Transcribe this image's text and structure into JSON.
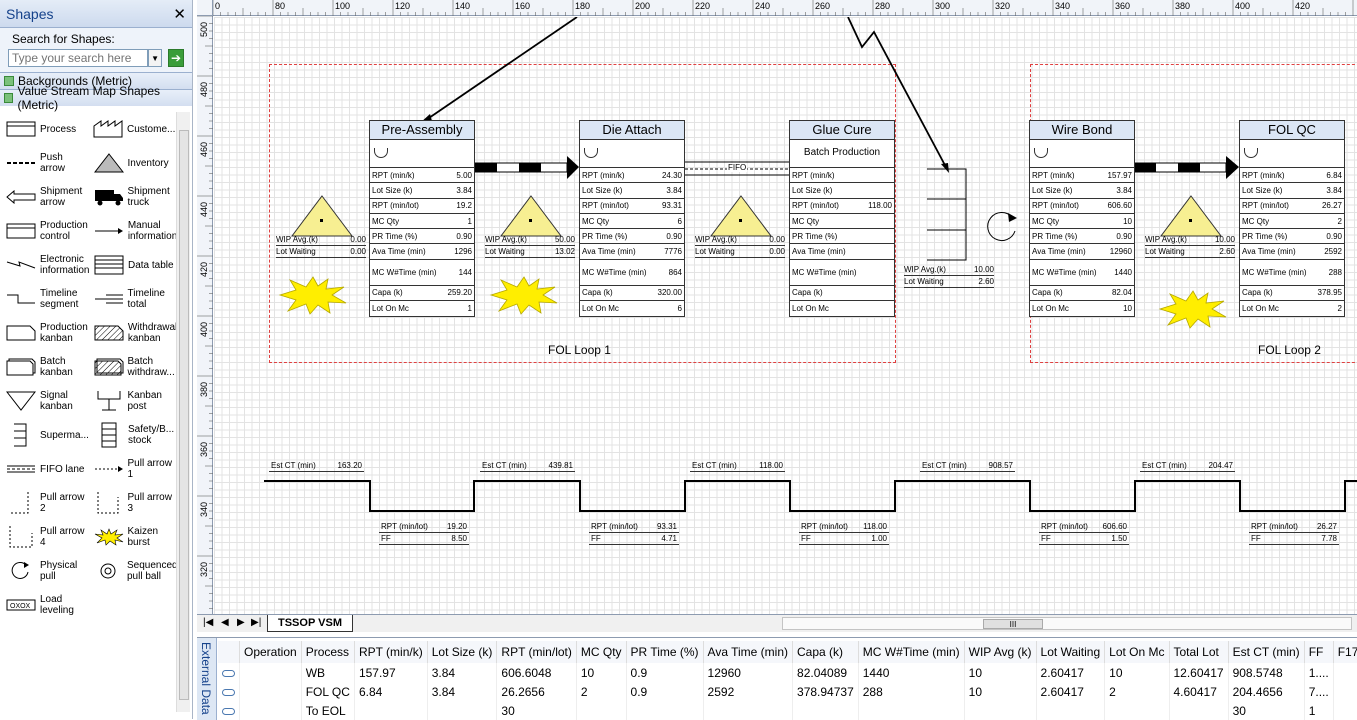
{
  "shapes_panel": {
    "title": "Shapes",
    "close_glyph": "✕",
    "search_label": "Search for Shapes:",
    "search_placeholder": "Type your search here",
    "stencils": [
      "Backgrounds (Metric)",
      "Value Stream Map Shapes (Metric)"
    ],
    "shapes": [
      [
        "Process",
        "Custome..."
      ],
      [
        "Push arrow",
        "Inventory"
      ],
      [
        "Shipment arrow",
        "Shipment truck"
      ],
      [
        "Production control",
        "Manual information"
      ],
      [
        "Electronic information",
        "Data table"
      ],
      [
        "Timeline segment",
        "Timeline total"
      ],
      [
        "Production kanban",
        "Withdrawal kanban"
      ],
      [
        "Batch kanban",
        "Batch withdraw..."
      ],
      [
        "Signal kanban",
        "Kanban post"
      ],
      [
        "",
        "Safety/B... stock"
      ],
      [
        "FIFO lane",
        "Pull arrow 1"
      ],
      [
        "Pull arrow 2",
        "Pull arrow 3"
      ],
      [
        "Pull arrow 4",
        "Kaizen burst"
      ],
      [
        "Physical pull",
        "Sequenced pull ball"
      ],
      [
        "Load leveling",
        ""
      ]
    ],
    "supermarket_label": "Superma..."
  },
  "ruler": {
    "top_ticks": [
      "0",
      "80",
      "100",
      "120",
      "140",
      "160",
      "180",
      "200",
      "220",
      "240",
      "260",
      "280",
      "300",
      "320",
      "340",
      "360",
      "380",
      "400",
      "420"
    ],
    "left_ticks": [
      "500",
      "480",
      "460",
      "440",
      "420",
      "400",
      "380",
      "360",
      "340",
      "320"
    ]
  },
  "diagram": {
    "loops": [
      "FOL Loop 1",
      "FOL Loop 2"
    ],
    "fifo_label": "FIFO",
    "row_labels": [
      "RPT (min/k)",
      "Lot Size (k)",
      "RPT (min/lot)",
      "MC Qty",
      "PR Time (%)",
      "Ava Time (min)",
      "MC W#Time (min)",
      "Capa (k)",
      "Lot On Mc"
    ],
    "processes": [
      {
        "title": "Pre-Assembly",
        "batch": "",
        "values": [
          "5.00",
          "3.84",
          "19.2",
          "1",
          "0.90",
          "1296",
          "144",
          "259.20",
          "1"
        ]
      },
      {
        "title": "Die Attach",
        "batch": "",
        "values": [
          "24.30",
          "3.84",
          "93.31",
          "6",
          "0.90",
          "7776",
          "864",
          "320.00",
          "6"
        ]
      },
      {
        "title": "Glue Cure",
        "batch": "Batch Production",
        "values": [
          "",
          "",
          "118.00",
          "",
          "",
          "",
          "",
          "",
          ""
        ]
      },
      {
        "title": "Wire Bond",
        "batch": "",
        "values": [
          "157.97",
          "3.84",
          "606.60",
          "10",
          "0.90",
          "12960",
          "1440",
          "82.04",
          "10"
        ]
      },
      {
        "title": "FOL QC",
        "batch": "",
        "values": [
          "6.84",
          "3.84",
          "26.27",
          "2",
          "0.90",
          "2592",
          "288",
          "378.95",
          "2"
        ]
      }
    ],
    "wip_label": "WIP Avg.(k)",
    "lot_waiting_label": "Lot Waiting",
    "inventories": [
      {
        "wip": "0.00",
        "lot": "0.00"
      },
      {
        "wip": "50.00",
        "lot": "13.02"
      },
      {
        "wip": "0.00",
        "lot": "0.00"
      },
      {
        "wip": "10.00",
        "lot": "2.60"
      },
      {
        "wip": "10.00",
        "lot": "2.60"
      }
    ],
    "timeline": {
      "est_ct_label": "Est CT (min)",
      "rpt_label": "RPT (min/lot)",
      "ff_label": "FF",
      "est_ct": [
        "163.20",
        "439.81",
        "118.00",
        "908.57",
        "204.47"
      ],
      "rpt": [
        "19.20",
        "93.31",
        "118.00",
        "606.60",
        "26.27"
      ],
      "ff": [
        "8.50",
        "4.71",
        "1.00",
        "1.50",
        "7.78"
      ]
    }
  },
  "tabs": {
    "nav": [
      "|◀",
      "◀",
      "▶",
      "▶|"
    ],
    "active_tab": "TSSOP VSM",
    "scroll_glyph": "III"
  },
  "external_data": {
    "side_label": "External Data",
    "columns": [
      "",
      "Operation",
      "Process",
      "RPT (min/k)",
      "Lot Size (k)",
      "RPT (min/lot)",
      "MC Qty",
      "PR Time (%)",
      "Ava Time (min)",
      "Capa (k)",
      "MC W#Time (min)",
      "WIP Avg (k)",
      "Lot Waiting",
      "Lot On Mc",
      "Total Lot",
      "Est CT (min)",
      "FF",
      "F17"
    ],
    "rows": [
      [
        "",
        "",
        "WB",
        "157.97",
        "3.84",
        "606.6048",
        "10",
        "0.9",
        "12960",
        "82.04089",
        "1440",
        "10",
        "2.60417",
        "10",
        "12.60417",
        "908.5748",
        "1....",
        ""
      ],
      [
        "",
        "",
        "FOL QC",
        "6.84",
        "3.84",
        "26.2656",
        "2",
        "0.9",
        "2592",
        "378.94737",
        "288",
        "10",
        "2.60417",
        "2",
        "4.60417",
        "204.4656",
        "7....",
        ""
      ],
      [
        "",
        "",
        "To EOL",
        "",
        "",
        "30",
        "",
        "",
        "",
        "",
        "",
        "",
        "",
        "",
        "",
        "30",
        "1",
        ""
      ]
    ]
  }
}
